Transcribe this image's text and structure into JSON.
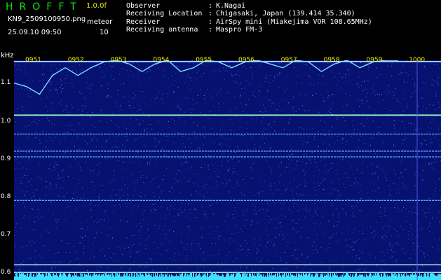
{
  "header": {
    "app_title": "HROFFT",
    "version": "1.0.0f",
    "file_name": "KN9_2509100950.png",
    "user_command": "meteor",
    "datetime": "25.09.10 09:50",
    "count": "10",
    "info": [
      {
        "label": "Observer",
        "value": "K.Nagai"
      },
      {
        "label": "Receiving Location",
        "value": "Chigasaki, Japan (139.414 35.340)"
      },
      {
        "label": "Receiver",
        "value": "AirSpy mini (Miakejima VOR 108.65MHz)"
      },
      {
        "label": "Receiving antenna",
        "value": "Maspro FM-3"
      }
    ]
  },
  "chart_data": {
    "type": "heatmap",
    "ylabel": "kHz",
    "yticks": [
      "1.1",
      "1.0",
      "0.9",
      "0.8",
      "0.7",
      "0.6"
    ],
    "ylim": [
      0.58,
      1.16
    ],
    "xticks": [
      "0951",
      "0952",
      "0953",
      "0954",
      "0955",
      "0956",
      "0957",
      "0958",
      "0959",
      "1000"
    ],
    "colors": {
      "background": "#071170",
      "noise": "#2f57ff",
      "trace": "#7fd7ff",
      "carrier": "#8affc8",
      "tick_label": "#f0f000"
    },
    "carriers_khz": [
      1.015,
      0.965,
      0.92,
      0.905,
      0.79,
      0.62,
      0.6
    ],
    "trace": [
      [
        0.0,
        1.1
      ],
      [
        0.03,
        1.09
      ],
      [
        0.06,
        1.07
      ],
      [
        0.09,
        1.12
      ],
      [
        0.12,
        1.14
      ],
      [
        0.15,
        1.12
      ],
      [
        0.18,
        1.14
      ],
      [
        0.21,
        1.155
      ],
      [
        0.24,
        1.16
      ],
      [
        0.27,
        1.15
      ],
      [
        0.3,
        1.13
      ],
      [
        0.33,
        1.15
      ],
      [
        0.36,
        1.16
      ],
      [
        0.39,
        1.13
      ],
      [
        0.42,
        1.14
      ],
      [
        0.45,
        1.16
      ],
      [
        0.48,
        1.155
      ],
      [
        0.51,
        1.14
      ],
      [
        0.54,
        1.155
      ],
      [
        0.57,
        1.16
      ],
      [
        0.6,
        1.15
      ],
      [
        0.63,
        1.14
      ],
      [
        0.66,
        1.16
      ],
      [
        0.69,
        1.155
      ],
      [
        0.72,
        1.13
      ],
      [
        0.75,
        1.15
      ],
      [
        0.78,
        1.16
      ],
      [
        0.81,
        1.14
      ],
      [
        0.84,
        1.155
      ],
      [
        0.87,
        1.16
      ],
      [
        0.9,
        1.16
      ]
    ]
  }
}
